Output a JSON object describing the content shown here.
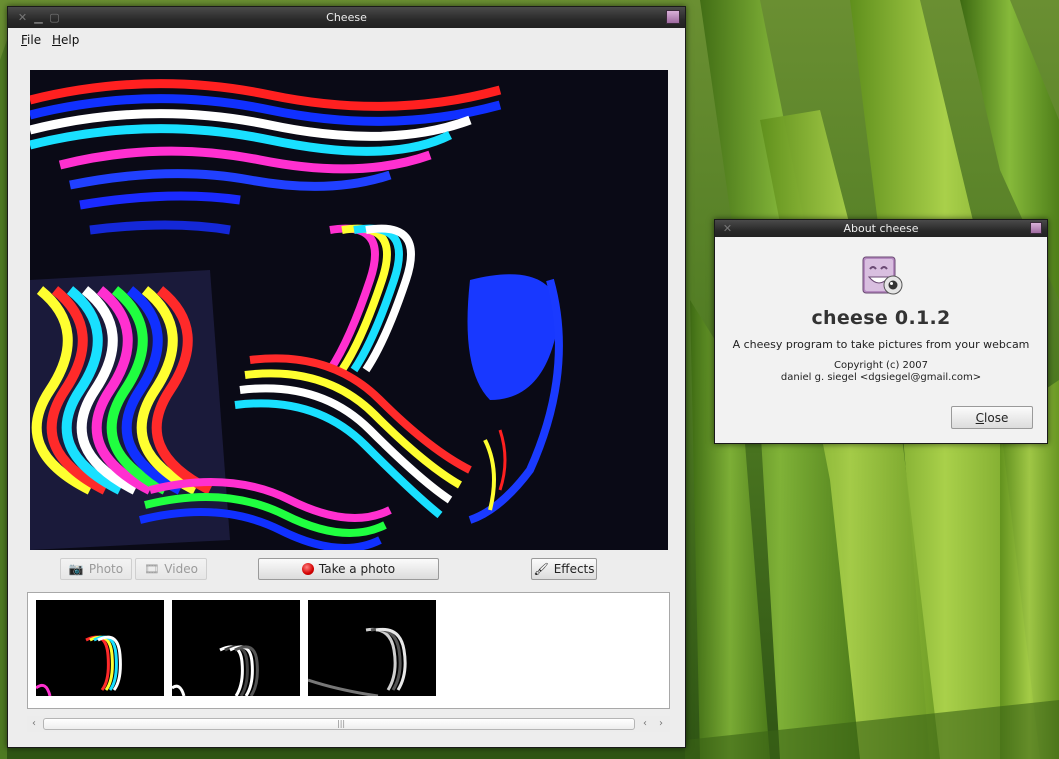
{
  "main_window": {
    "title": "Cheese",
    "menu": [
      {
        "key": "F",
        "rest": "ile"
      },
      {
        "key": "H",
        "rest": "elp"
      }
    ],
    "mode_photo_label": "Photo",
    "mode_video_label": "Video",
    "take_photo_label": "Take a photo",
    "effects_label": "Effects",
    "scrollbar_grip": "|||"
  },
  "about_window": {
    "title": "About cheese",
    "app_name": "cheese 0.1.2",
    "description": "A cheesy program to take pictures from your webcam",
    "copyright": "Copyright (c) 2007",
    "author": "daniel g. siegel <dgsiegel@gmail.com>",
    "close_key": "C",
    "close_rest": "lose"
  },
  "colors": {
    "accent_record": "#d40000",
    "video_bg": "#0a0a16",
    "desktop_grass": "#5e8a2c"
  },
  "icons": [
    "close-icon",
    "minimize-icon",
    "camera-icon",
    "video-icon",
    "record-icon",
    "brush-icon",
    "cheese-logo-icon",
    "scroll-left-icon",
    "scroll-right-icon"
  ]
}
